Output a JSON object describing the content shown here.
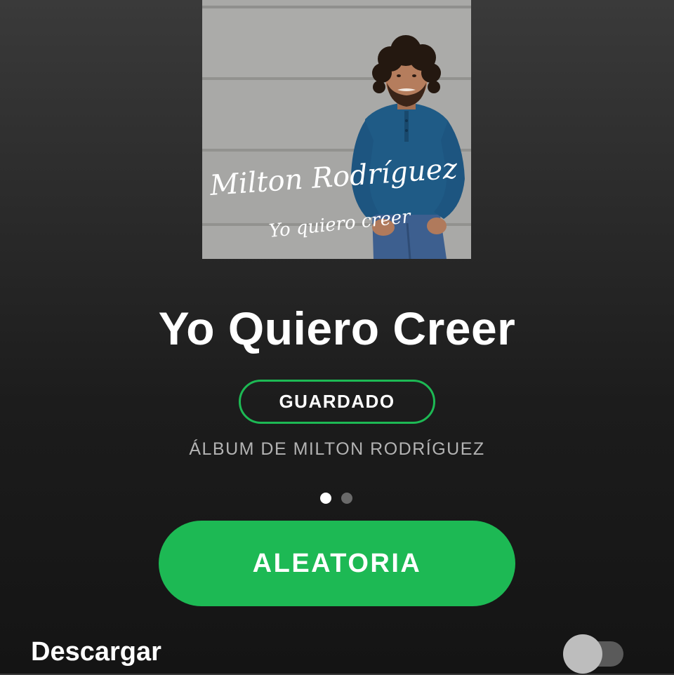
{
  "album": {
    "cover": {
      "artist_script": "Milton Rodríguez",
      "title_script": "Yo quiero creer"
    },
    "title": "Yo Quiero Creer",
    "saved_label": "GUARDADO",
    "subtitle": "ÁLBUM DE MILTON RODRÍGUEZ"
  },
  "pager": {
    "pages": 2,
    "active_page": 1
  },
  "actions": {
    "shuffle_label": "ALEATORIA"
  },
  "download": {
    "label": "Descargar",
    "enabled": false
  },
  "colors": {
    "accent": "#1db954",
    "background_top": "#3a3a3a",
    "background_bottom": "#141414",
    "subtitle_text": "#b3b3b3",
    "dot_inactive": "#6a6a6a",
    "toggle_knob": "#bdbdbd",
    "toggle_track": "#5a5a5a"
  }
}
